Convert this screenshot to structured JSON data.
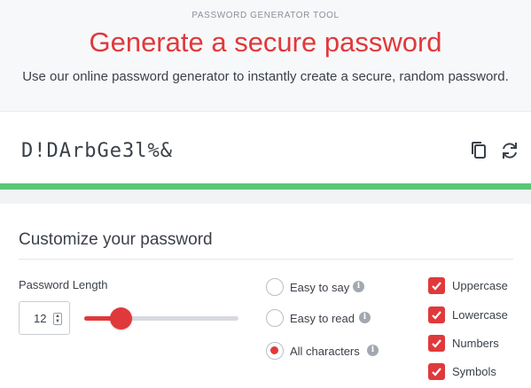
{
  "hero": {
    "eyebrow": "PASSWORD GENERATOR TOOL",
    "title": "Generate a secure password",
    "subtitle": "Use our online password generator to instantly create a secure, random password."
  },
  "password": {
    "value": "D!DArbGe3l%&",
    "strength_color": "#58c777",
    "copy_icon": "copy-icon",
    "refresh_icon": "refresh-icon"
  },
  "customize": {
    "title": "Customize your password",
    "length_label": "Password Length",
    "length_value": "12",
    "slider_fraction": 0.24,
    "radios": [
      {
        "label": "Easy to say",
        "checked": false
      },
      {
        "label": "Easy to read",
        "checked": false
      },
      {
        "label": "All characters",
        "checked": true
      }
    ],
    "checkboxes": [
      {
        "label": "Uppercase",
        "checked": true
      },
      {
        "label": "Lowercase",
        "checked": true
      },
      {
        "label": "Numbers",
        "checked": true
      },
      {
        "label": "Symbols",
        "checked": true
      }
    ]
  },
  "colors": {
    "accent": "#e0393b",
    "strength": "#58c777"
  }
}
